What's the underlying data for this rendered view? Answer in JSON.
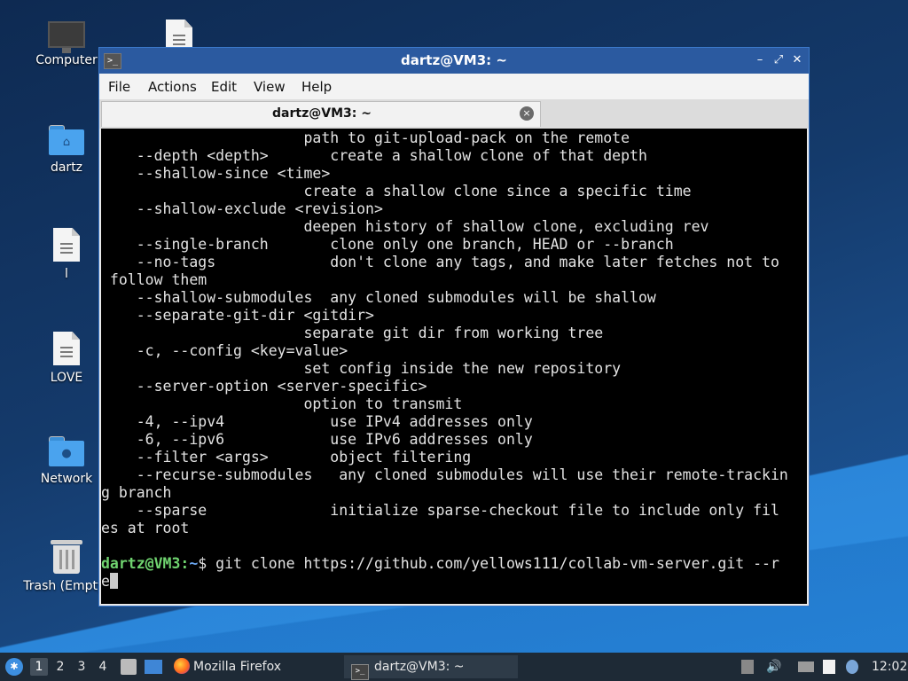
{
  "desktop": {
    "icons": [
      {
        "label": "Computer"
      },
      {
        "label": ""
      },
      {
        "label": "dartz"
      },
      {
        "label": "l"
      },
      {
        "label": "LOVE"
      },
      {
        "label": "Network"
      },
      {
        "label": "Trash (Empty)"
      }
    ]
  },
  "window": {
    "title": "dartz@VM3: ~",
    "controls": {
      "minimize": "–",
      "maximize": "⤢",
      "close": "✕"
    },
    "menu": [
      "File",
      "Actions",
      "Edit",
      "View",
      "Help"
    ],
    "tab": {
      "label": "dartz@VM3: ~",
      "close": "×"
    }
  },
  "terminal": {
    "lines": [
      "                       path to git-upload-pack on the remote",
      "    --depth <depth>       create a shallow clone of that depth",
      "    --shallow-since <time>",
      "                       create a shallow clone since a specific time",
      "    --shallow-exclude <revision>",
      "                       deepen history of shallow clone, excluding rev",
      "    --single-branch       clone only one branch, HEAD or --branch",
      "    --no-tags             don't clone any tags, and make later fetches not to",
      " follow them",
      "    --shallow-submodules  any cloned submodules will be shallow",
      "    --separate-git-dir <gitdir>",
      "                       separate git dir from working tree",
      "    -c, --config <key=value>",
      "                       set config inside the new repository",
      "    --server-option <server-specific>",
      "                       option to transmit",
      "    -4, --ipv4            use IPv4 addresses only",
      "    -6, --ipv6            use IPv6 addresses only",
      "    --filter <args>       object filtering",
      "    --recurse-submodules   any cloned submodules will use their remote-trackin",
      "g branch",
      "    --sparse              initialize sparse-checkout file to include only fil",
      "es at root",
      ""
    ],
    "prompt": {
      "user_host": "dartz@VM3",
      "sep": ":",
      "path": "~",
      "dollar": "$ ",
      "command": "git clone https://github.com/yellows111/collab-vm-server.git --r",
      "wrap": "e"
    }
  },
  "taskbar": {
    "start_icon": "start-menu-icon",
    "workspaces": [
      "1",
      "2",
      "3",
      "4"
    ],
    "tasks": [
      {
        "label": "Mozilla Firefox",
        "icon": "firefox-icon"
      },
      {
        "label": "dartz@VM3: ~",
        "icon": "terminal-icon"
      }
    ],
    "clock": "12:02"
  },
  "colors": {
    "titlebar": "#2b5aa0",
    "prompt_user": "#6fd36f",
    "prompt_path": "#6aa6f0",
    "terminal_bg": "#000000",
    "taskbar_bg": "#1e2a36"
  }
}
